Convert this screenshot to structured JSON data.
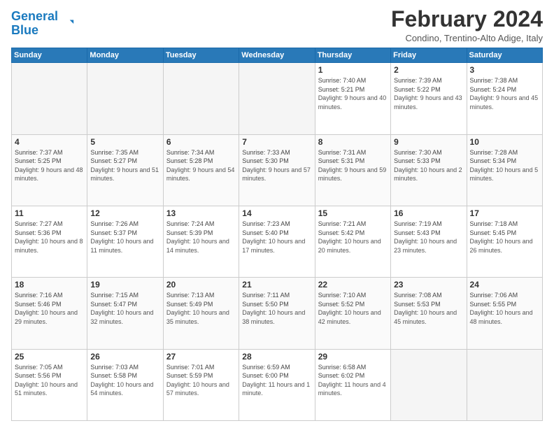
{
  "header": {
    "logo_general": "General",
    "logo_blue": "Blue",
    "month_title": "February 2024",
    "location": "Condino, Trentino-Alto Adige, Italy"
  },
  "days_of_week": [
    "Sunday",
    "Monday",
    "Tuesday",
    "Wednesday",
    "Thursday",
    "Friday",
    "Saturday"
  ],
  "weeks": [
    [
      {
        "day": "",
        "empty": true
      },
      {
        "day": "",
        "empty": true
      },
      {
        "day": "",
        "empty": true
      },
      {
        "day": "",
        "empty": true
      },
      {
        "day": "1",
        "sunrise": "7:40 AM",
        "sunset": "5:21 PM",
        "daylight": "9 hours and 40 minutes."
      },
      {
        "day": "2",
        "sunrise": "7:39 AM",
        "sunset": "5:22 PM",
        "daylight": "9 hours and 43 minutes."
      },
      {
        "day": "3",
        "sunrise": "7:38 AM",
        "sunset": "5:24 PM",
        "daylight": "9 hours and 45 minutes."
      }
    ],
    [
      {
        "day": "4",
        "sunrise": "7:37 AM",
        "sunset": "5:25 PM",
        "daylight": "9 hours and 48 minutes."
      },
      {
        "day": "5",
        "sunrise": "7:35 AM",
        "sunset": "5:27 PM",
        "daylight": "9 hours and 51 minutes."
      },
      {
        "day": "6",
        "sunrise": "7:34 AM",
        "sunset": "5:28 PM",
        "daylight": "9 hours and 54 minutes."
      },
      {
        "day": "7",
        "sunrise": "7:33 AM",
        "sunset": "5:30 PM",
        "daylight": "9 hours and 57 minutes."
      },
      {
        "day": "8",
        "sunrise": "7:31 AM",
        "sunset": "5:31 PM",
        "daylight": "9 hours and 59 minutes."
      },
      {
        "day": "9",
        "sunrise": "7:30 AM",
        "sunset": "5:33 PM",
        "daylight": "10 hours and 2 minutes."
      },
      {
        "day": "10",
        "sunrise": "7:28 AM",
        "sunset": "5:34 PM",
        "daylight": "10 hours and 5 minutes."
      }
    ],
    [
      {
        "day": "11",
        "sunrise": "7:27 AM",
        "sunset": "5:36 PM",
        "daylight": "10 hours and 8 minutes."
      },
      {
        "day": "12",
        "sunrise": "7:26 AM",
        "sunset": "5:37 PM",
        "daylight": "10 hours and 11 minutes."
      },
      {
        "day": "13",
        "sunrise": "7:24 AM",
        "sunset": "5:39 PM",
        "daylight": "10 hours and 14 minutes."
      },
      {
        "day": "14",
        "sunrise": "7:23 AM",
        "sunset": "5:40 PM",
        "daylight": "10 hours and 17 minutes."
      },
      {
        "day": "15",
        "sunrise": "7:21 AM",
        "sunset": "5:42 PM",
        "daylight": "10 hours and 20 minutes."
      },
      {
        "day": "16",
        "sunrise": "7:19 AM",
        "sunset": "5:43 PM",
        "daylight": "10 hours and 23 minutes."
      },
      {
        "day": "17",
        "sunrise": "7:18 AM",
        "sunset": "5:45 PM",
        "daylight": "10 hours and 26 minutes."
      }
    ],
    [
      {
        "day": "18",
        "sunrise": "7:16 AM",
        "sunset": "5:46 PM",
        "daylight": "10 hours and 29 minutes."
      },
      {
        "day": "19",
        "sunrise": "7:15 AM",
        "sunset": "5:47 PM",
        "daylight": "10 hours and 32 minutes."
      },
      {
        "day": "20",
        "sunrise": "7:13 AM",
        "sunset": "5:49 PM",
        "daylight": "10 hours and 35 minutes."
      },
      {
        "day": "21",
        "sunrise": "7:11 AM",
        "sunset": "5:50 PM",
        "daylight": "10 hours and 38 minutes."
      },
      {
        "day": "22",
        "sunrise": "7:10 AM",
        "sunset": "5:52 PM",
        "daylight": "10 hours and 42 minutes."
      },
      {
        "day": "23",
        "sunrise": "7:08 AM",
        "sunset": "5:53 PM",
        "daylight": "10 hours and 45 minutes."
      },
      {
        "day": "24",
        "sunrise": "7:06 AM",
        "sunset": "5:55 PM",
        "daylight": "10 hours and 48 minutes."
      }
    ],
    [
      {
        "day": "25",
        "sunrise": "7:05 AM",
        "sunset": "5:56 PM",
        "daylight": "10 hours and 51 minutes."
      },
      {
        "day": "26",
        "sunrise": "7:03 AM",
        "sunset": "5:58 PM",
        "daylight": "10 hours and 54 minutes."
      },
      {
        "day": "27",
        "sunrise": "7:01 AM",
        "sunset": "5:59 PM",
        "daylight": "10 hours and 57 minutes."
      },
      {
        "day": "28",
        "sunrise": "6:59 AM",
        "sunset": "6:00 PM",
        "daylight": "11 hours and 1 minute."
      },
      {
        "day": "29",
        "sunrise": "6:58 AM",
        "sunset": "6:02 PM",
        "daylight": "11 hours and 4 minutes."
      },
      {
        "day": "",
        "empty": true
      },
      {
        "day": "",
        "empty": true
      }
    ]
  ],
  "labels": {
    "sunrise": "Sunrise:",
    "sunset": "Sunset:",
    "daylight": "Daylight:"
  }
}
